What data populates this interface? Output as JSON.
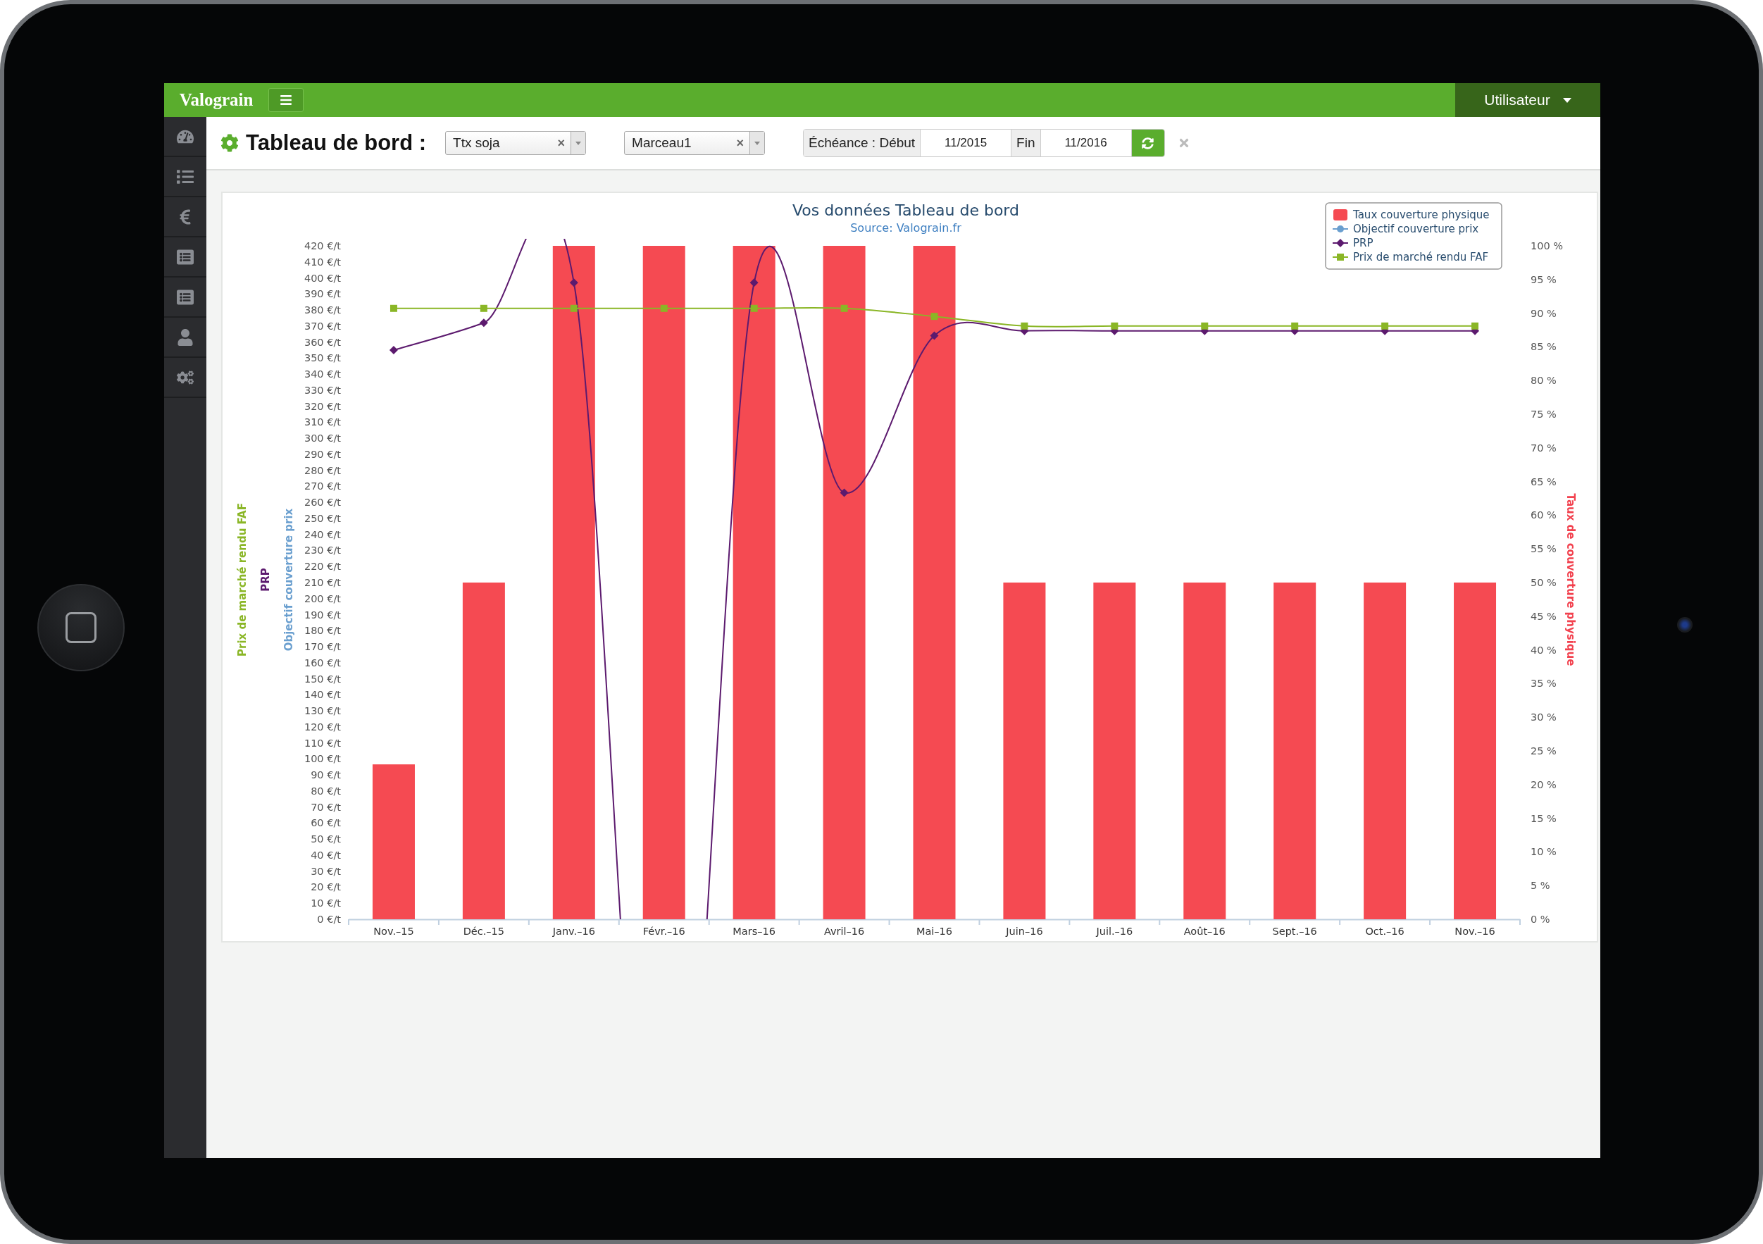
{
  "topbar": {
    "logo": "Valograin",
    "user_menu": "Utilisateur"
  },
  "sidebar": {
    "items": [
      {
        "kind": "gauge"
      },
      {
        "kind": "list"
      },
      {
        "kind": "euro"
      },
      {
        "kind": "list-alt"
      },
      {
        "kind": "list-alt"
      },
      {
        "kind": "user"
      },
      {
        "kind": "cogs"
      }
    ]
  },
  "toolbar": {
    "title": "Tableau de bord :",
    "selects": [
      {
        "value": "Ttx soja",
        "clear": "×"
      },
      {
        "value": "Marceau1",
        "clear": "×"
      }
    ],
    "date_range": {
      "label": "Échéance : Début",
      "start": "11/2015",
      "end_label": "Fin",
      "end": "11/2016"
    }
  },
  "chart": {
    "subtitle": "Source: Valograin.fr",
    "left_axis_titles": [
      {
        "text": "Prix de marché rendu FAF",
        "color": "#8ab626"
      },
      {
        "text": "PRP",
        "color": "#5c1a6e"
      },
      {
        "text": "Objectif couverture prix",
        "color": "#6a9fcf"
      }
    ],
    "right_axis": {
      "title": "Taux de couverture physique",
      "color": "#f2414e"
    },
    "chart_data": {
      "type": "bar",
      "title": "Vos données Tableau de bord",
      "categories": [
        "Nov.–15",
        "Déc.–15",
        "Janv.–16",
        "Févr.–16",
        "Mars–16",
        "Avril–16",
        "Mai–16",
        "Juin–16",
        "Juil.–16",
        "Août–16",
        "Sept.–16",
        "Oct.–16",
        "Nov.–16"
      ],
      "ylim": [
        0,
        420
      ],
      "y2lim": [
        0,
        100
      ],
      "y2ticks": [
        {
          "value": 100,
          "label": "100 %"
        },
        {
          "value": 95,
          "label": "95 %"
        },
        {
          "value": 90,
          "label": "90 %"
        },
        {
          "value": 85,
          "label": "85 %"
        },
        {
          "value": 80,
          "label": "80 %"
        },
        {
          "value": 75,
          "label": "75 %"
        },
        {
          "value": 70,
          "label": "70 %"
        },
        {
          "value": 65,
          "label": "65 %"
        },
        {
          "value": 60,
          "label": "60 %"
        },
        {
          "value": 55,
          "label": "55 %"
        },
        {
          "value": 50,
          "label": "50 %"
        },
        {
          "value": 45,
          "label": "45 %"
        },
        {
          "value": 40,
          "label": "40 %"
        },
        {
          "value": 35,
          "label": "35 %"
        },
        {
          "value": 30,
          "label": "30 %"
        },
        {
          "value": 25,
          "label": "25 %"
        },
        {
          "value": 20,
          "label": "20 %"
        },
        {
          "value": 15,
          "label": "15 %"
        },
        {
          "value": 10,
          "label": "10 %"
        },
        {
          "value": 5,
          "label": "5 %"
        },
        {
          "value": 0,
          "label": "0 %"
        }
      ],
      "legend": "top-right",
      "yticks": [
        {
          "value": 0,
          "label": "0 €/t"
        },
        {
          "value": 10,
          "label": "10 €/t"
        },
        {
          "value": 20,
          "label": "20 €/t"
        },
        {
          "value": 30,
          "label": "30 €/t"
        },
        {
          "value": 40,
          "label": "40 €/t"
        },
        {
          "value": 50,
          "label": "50 €/t"
        },
        {
          "value": 60,
          "label": "60 €/t"
        },
        {
          "value": 70,
          "label": "70 €/t"
        },
        {
          "value": 80,
          "label": "80 €/t"
        },
        {
          "value": 90,
          "label": "90 €/t"
        },
        {
          "value": 100,
          "label": "100 €/t"
        },
        {
          "value": 110,
          "label": "110 €/t"
        },
        {
          "value": 120,
          "label": "120 €/t"
        },
        {
          "value": 130,
          "label": "130 €/t"
        },
        {
          "value": 140,
          "label": "140 €/t"
        },
        {
          "value": 150,
          "label": "150 €/t"
        },
        {
          "value": 160,
          "label": "160 €/t"
        },
        {
          "value": 170,
          "label": "170 €/t"
        },
        {
          "value": 180,
          "label": "180 €/t"
        },
        {
          "value": 190,
          "label": "190 €/t"
        },
        {
          "value": 200,
          "label": "200 €/t"
        },
        {
          "value": 210,
          "label": "210 €/t"
        },
        {
          "value": 220,
          "label": "220 €/t"
        },
        {
          "value": 230,
          "label": "230 €/t"
        },
        {
          "value": 240,
          "label": "240 €/t"
        },
        {
          "value": 250,
          "label": "250 €/t"
        },
        {
          "value": 260,
          "label": "260 €/t"
        },
        {
          "value": 270,
          "label": "270 €/t"
        },
        {
          "value": 280,
          "label": "280 €/t"
        },
        {
          "value": 290,
          "label": "290 €/t"
        },
        {
          "value": 300,
          "label": "300 €/t"
        },
        {
          "value": 310,
          "label": "310 €/t"
        },
        {
          "value": 320,
          "label": "320 €/t"
        },
        {
          "value": 330,
          "label": "330 €/t"
        },
        {
          "value": 340,
          "label": "340 €/t"
        },
        {
          "value": 350,
          "label": "350 €/t"
        },
        {
          "value": 360,
          "label": "360 €/t"
        },
        {
          "value": 370,
          "label": "370 €/t"
        },
        {
          "value": 380,
          "label": "380 €/t"
        },
        {
          "value": 390,
          "label": "390 €/t"
        },
        {
          "value": 400,
          "label": "400 €/t"
        },
        {
          "value": 410,
          "label": "410 €/t"
        },
        {
          "value": 420,
          "label": "420 €/t"
        }
      ],
      "series": [
        {
          "name": "Taux couverture physique",
          "axis": "y2",
          "color": "#f54a52",
          "values": [
            23,
            50,
            100,
            100,
            100,
            100,
            100,
            50,
            50,
            50,
            50,
            50,
            50
          ]
        },
        {
          "name": "Objectif couverture prix",
          "type": "line",
          "marker": "circle",
          "color": "#6a9fcf",
          "values": [
            null,
            null,
            null,
            null,
            null,
            null,
            null,
            null,
            null,
            null,
            null,
            null,
            null
          ]
        },
        {
          "name": "PRP",
          "type": "line",
          "marker": "diamond",
          "color": "#5c1a6e",
          "values": [
            355,
            372,
            397,
            null,
            397,
            266,
            364,
            367,
            367,
            367,
            367,
            367,
            367
          ]
        },
        {
          "name": "Prix de marché rendu FAF",
          "type": "line",
          "marker": "square",
          "color": "#8ab626",
          "values": [
            381,
            381,
            381,
            381,
            381,
            381,
            376,
            370,
            370,
            370,
            370,
            370,
            370
          ]
        }
      ]
    }
  }
}
